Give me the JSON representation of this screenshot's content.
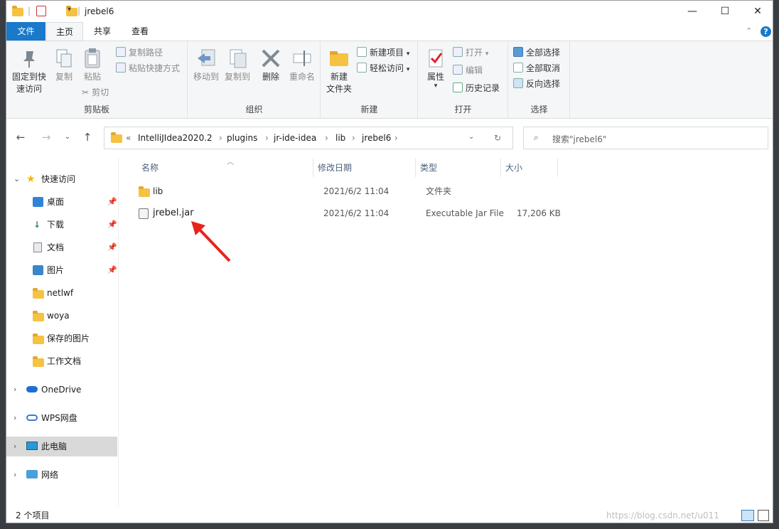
{
  "window": {
    "title": "jrebel6",
    "minimize": "—",
    "maximize": "☐",
    "close": "✕"
  },
  "tabs": {
    "file": "文件",
    "home": "主页",
    "share": "共享",
    "view": "查看"
  },
  "ribbon": {
    "clipboard": {
      "label": "剪贴板",
      "pin": "固定到快速访问",
      "copy": "复制",
      "paste": "粘贴",
      "copy_path": "复制路径",
      "paste_shortcut": "粘贴快捷方式",
      "cut": "剪切"
    },
    "organize": {
      "label": "组织",
      "move_to": "移动到",
      "copy_to": "复制到",
      "delete": "删除",
      "rename": "重命名"
    },
    "new": {
      "label": "新建",
      "new_folder": "新建\n文件夹",
      "new_item": "新建项目",
      "easy_access": "轻松访问"
    },
    "open": {
      "label": "打开",
      "properties": "属性",
      "open": "打开",
      "edit": "编辑",
      "history": "历史记录"
    },
    "select": {
      "label": "选择",
      "select_all": "全部选择",
      "select_none": "全部取消",
      "invert": "反向选择"
    }
  },
  "address": {
    "prefix": "«",
    "crumbs": [
      "IntelliJIdea2020.2",
      "plugins",
      "jr-ide-idea",
      "lib",
      "jrebel6"
    ],
    "search_placeholder": "搜索\"jrebel6\""
  },
  "sidebar": {
    "quick_access": "快速访问",
    "items": [
      {
        "label": "桌面",
        "pinned": true
      },
      {
        "label": "下载",
        "pinned": true
      },
      {
        "label": "文档",
        "pinned": true
      },
      {
        "label": "图片",
        "pinned": true
      },
      {
        "label": "netlwf",
        "pinned": false
      },
      {
        "label": "woya",
        "pinned": false
      },
      {
        "label": "保存的图片",
        "pinned": false
      },
      {
        "label": "工作文档",
        "pinned": false
      }
    ],
    "onedrive": "OneDrive",
    "wps": "WPS网盘",
    "this_pc": "此电脑",
    "network": "网络"
  },
  "columns": {
    "name": "名称",
    "date": "修改日期",
    "type": "类型",
    "size": "大小"
  },
  "files": [
    {
      "name": "lib",
      "date": "2021/6/2 11:04",
      "type": "文件夹",
      "size": ""
    },
    {
      "name": "jrebel.jar",
      "date": "2021/6/2 11:04",
      "type": "Executable Jar File",
      "size": "17,206 KB"
    }
  ],
  "status": {
    "count": "2 个项目"
  },
  "watermark": "https://blog.csdn.net/u011"
}
